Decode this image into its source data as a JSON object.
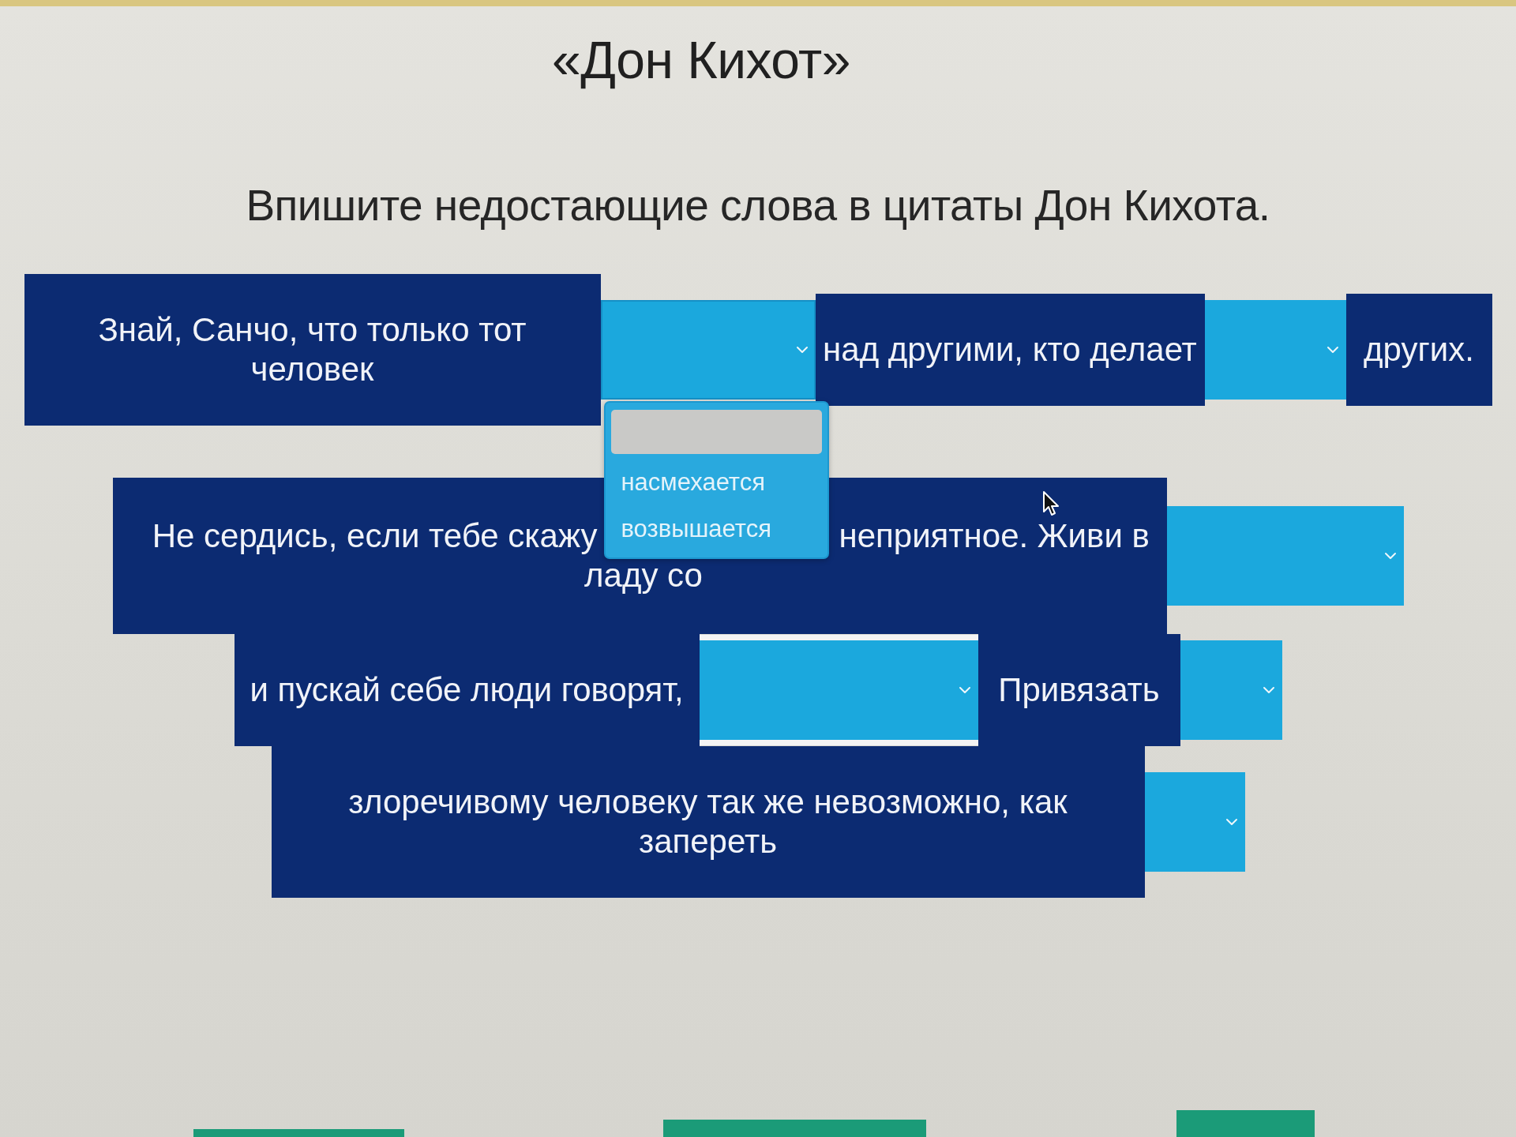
{
  "title": "«Дон Кихот»",
  "instruction": "Впишите недостающие слова в цитаты Дон Кихота.",
  "quotes": [
    {
      "lines": [
        {
          "items": [
            {
              "kind": "text",
              "text": "Знай, Санчо, что только тот человек"
            },
            {
              "kind": "blank",
              "open": true,
              "focused": false,
              "menu": {
                "blank_option": {
                  "selected": true
                },
                "options": [
                  {
                    "label": "насмехается",
                    "selected": false
                  },
                  {
                    "label": "возвышается",
                    "selected": false
                  }
                ]
              }
            },
            {
              "kind": "text",
              "text": "над другими, кто делает"
            },
            {
              "kind": "blank",
              "open": false,
              "focused": false
            },
            {
              "kind": "text",
              "text": "других."
            }
          ]
        }
      ]
    },
    {
      "lines": [
        {
          "items": [
            {
              "kind": "covered_text",
              "before": "Не сердись, если тебе скажу",
              "after": "неприятное. Живи в",
              "continued": "ладу со"
            },
            {
              "kind": "blank",
              "open": false,
              "focused": false
            }
          ]
        },
        {
          "items": [
            {
              "kind": "text",
              "text": "и пускай себе люди говорят,"
            },
            {
              "kind": "blank",
              "open": false,
              "focused": true
            },
            {
              "kind": "text",
              "text": "Привязать"
            },
            {
              "kind": "blank",
              "open": false,
              "focused": false
            }
          ]
        },
        {
          "items": [
            {
              "kind": "text",
              "text": "злоречивому человеку так же невозможно, как запереть"
            },
            {
              "kind": "blank",
              "open": false,
              "focused": false
            }
          ]
        }
      ]
    }
  ]
}
